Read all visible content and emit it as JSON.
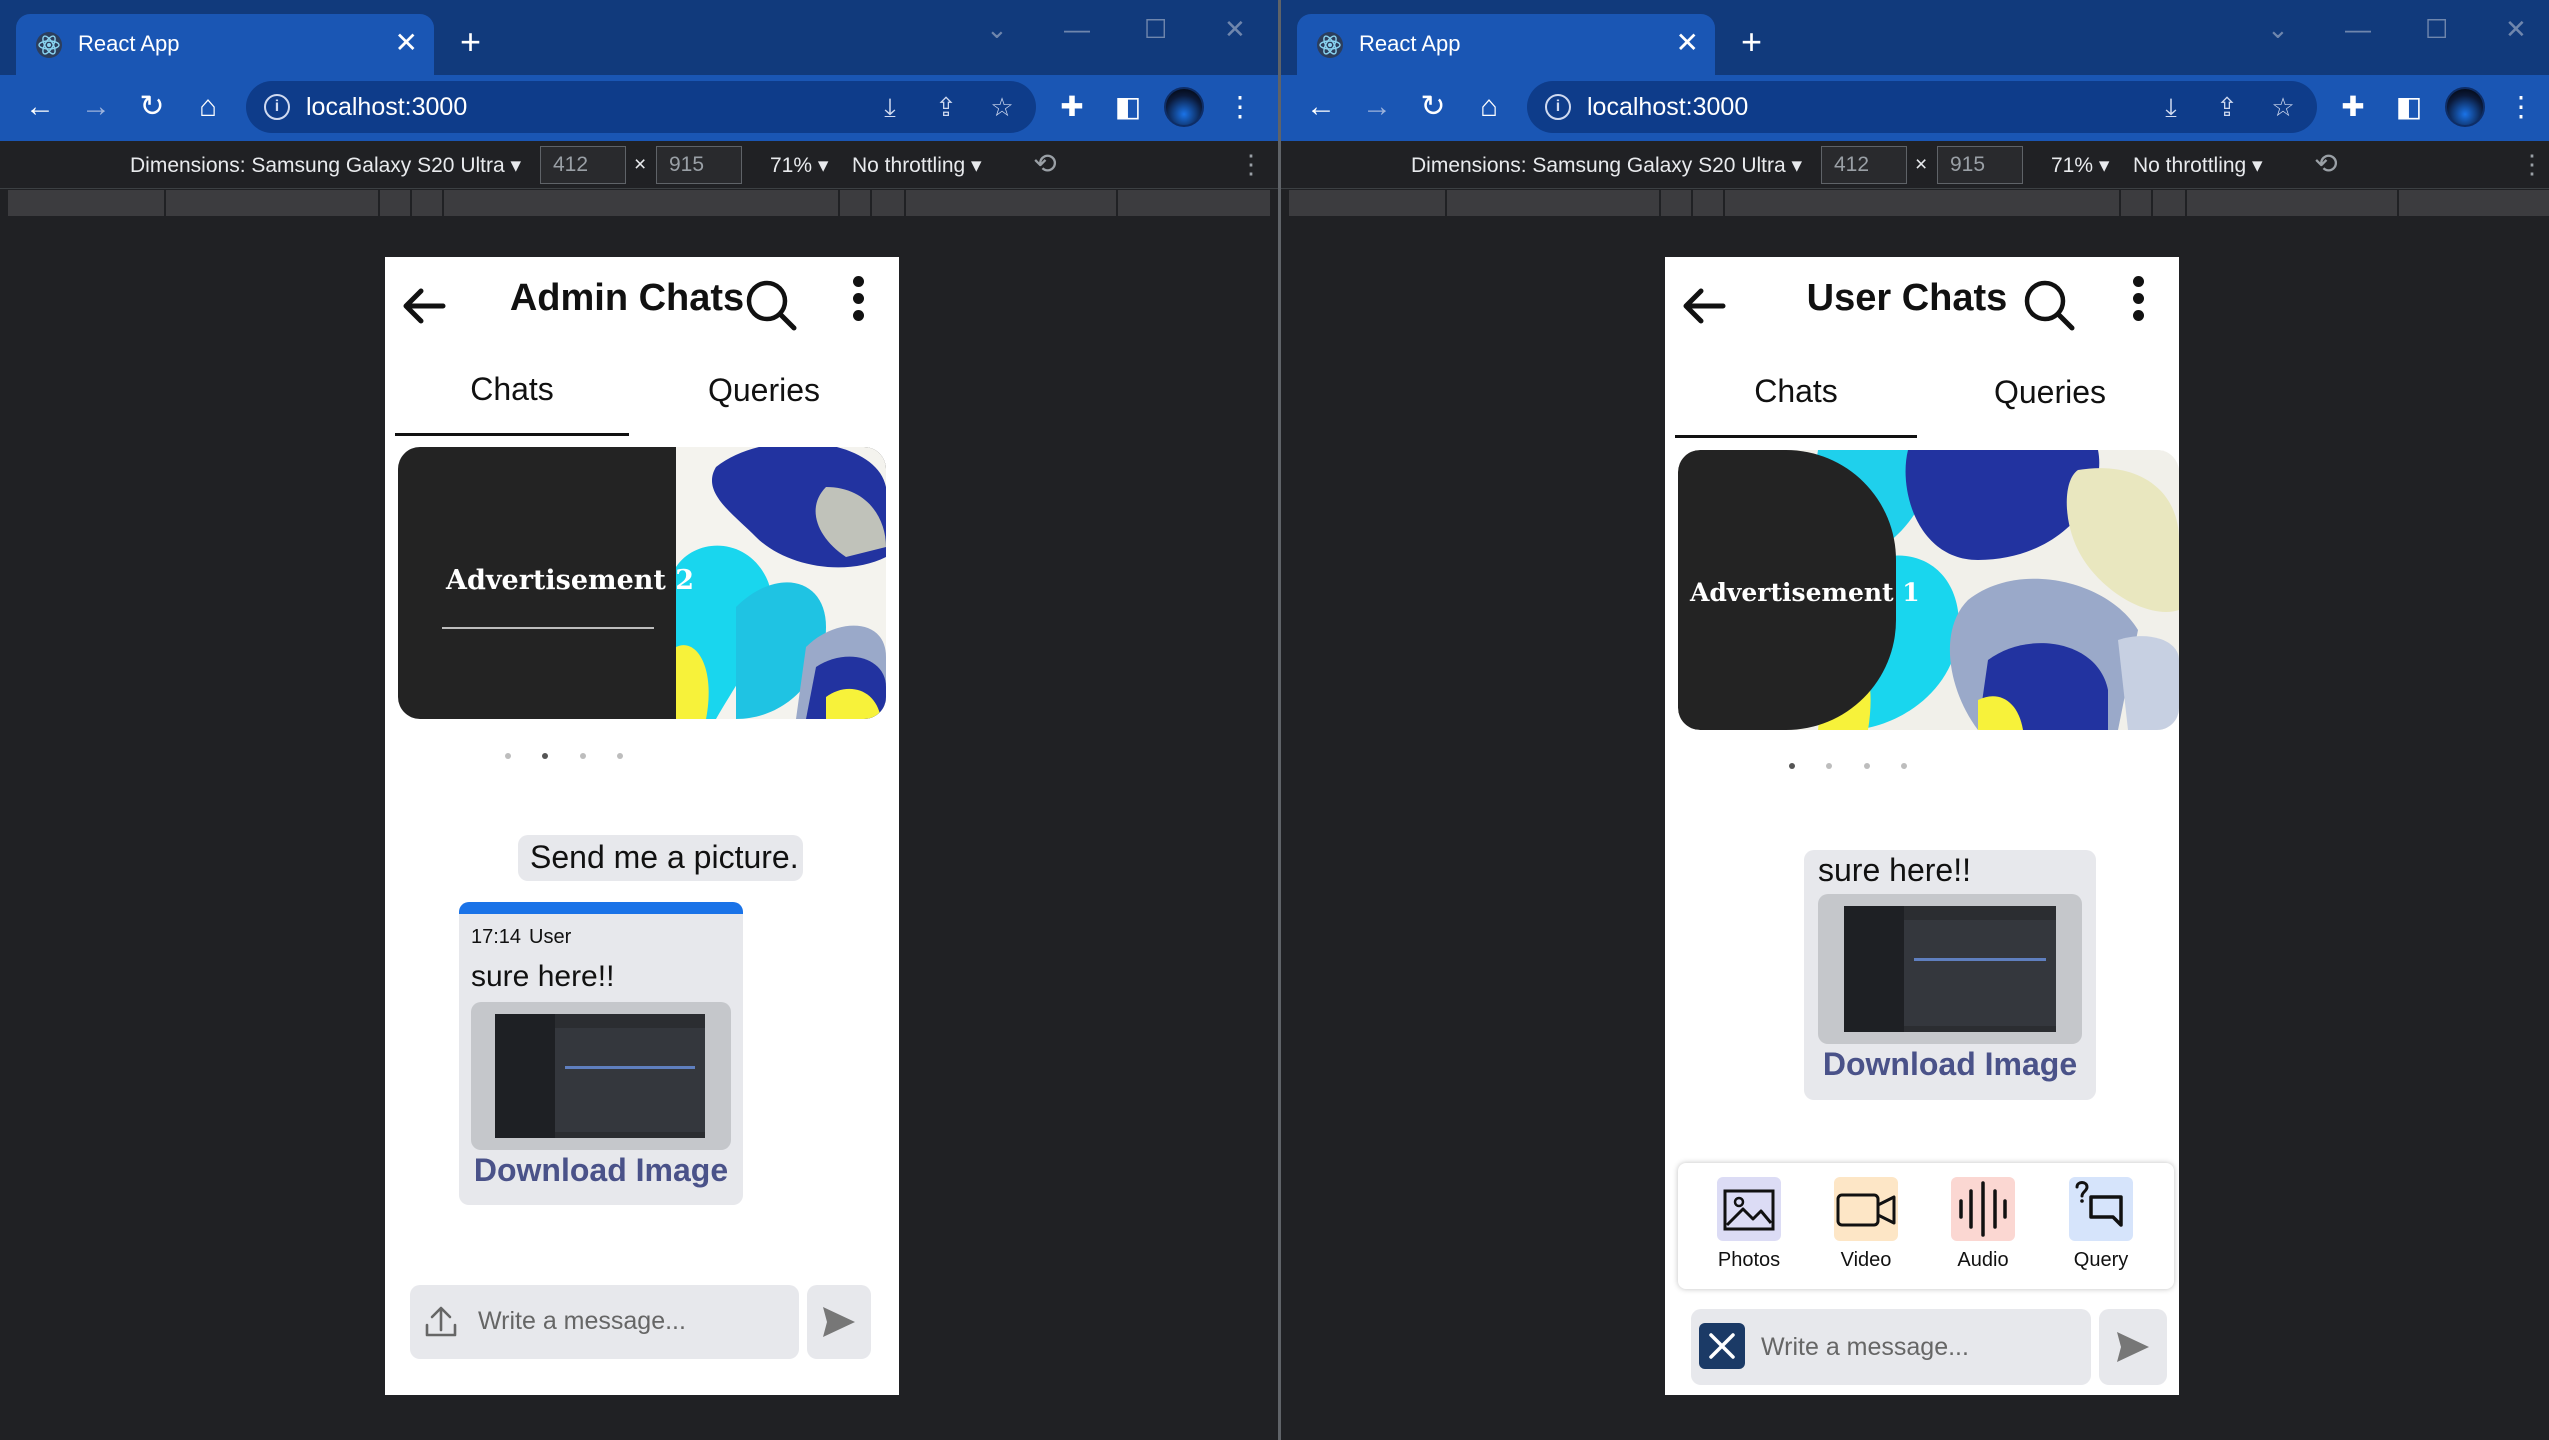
{
  "left_window": {
    "tab_title": "React App",
    "url": "localhost:3000",
    "device_toolbar": {
      "dimensions_label": "Dimensions: Samsung Galaxy S20 Ultra ▾",
      "width_value": "412",
      "times": "×",
      "height_value": "915",
      "zoom": "71% ▾",
      "throttling": "No throttling ▾"
    },
    "app": {
      "title": "Admin Chats",
      "tabs": [
        "Chats",
        "Queries"
      ],
      "active_tab": "Chats",
      "advertisement": "Advertisement 2",
      "carousel_active_index": 1,
      "carousel_dots": 4,
      "messages": {
        "incoming_text": "Send me a picture.",
        "card_time": "17:14",
        "card_sender": "User",
        "card_text": "sure here!!",
        "download_label": "Download Image"
      },
      "composer": {
        "placeholder": "Write a message...",
        "upload_icon": "upload-icon",
        "send_icon": "send-icon"
      }
    }
  },
  "right_window": {
    "tab_title": "React App",
    "url": "localhost:3000",
    "device_toolbar": {
      "dimensions_label": "Dimensions: Samsung Galaxy S20 Ultra ▾",
      "width_value": "412",
      "times": "×",
      "height_value": "915",
      "zoom": "71% ▾",
      "throttling": "No throttling ▾"
    },
    "app": {
      "title": "User Chats",
      "tabs": [
        "Chats",
        "Queries"
      ],
      "active_tab": "Chats",
      "advertisement": "Advertisement 1",
      "carousel_active_index": 0,
      "carousel_dots": 4,
      "messages": {
        "card_text": "sure here!!",
        "download_label": "Download Image"
      },
      "attachments": [
        {
          "label": "Photos",
          "icon": "image-icon",
          "color": "#dcdcf5"
        },
        {
          "label": "Video",
          "icon": "video-icon",
          "color": "#fde6c6"
        },
        {
          "label": "Audio",
          "icon": "audio-icon",
          "color": "#fbd7d2"
        },
        {
          "label": "Query",
          "icon": "query-icon",
          "color": "#d6e4fb"
        }
      ],
      "composer": {
        "placeholder": "Write a message...",
        "close_icon": "close-icon",
        "send_icon": "send-icon"
      }
    }
  },
  "colors": {
    "chrome_titlebar": "#113a7c",
    "chrome_toolbar": "#1a56b4",
    "devtools_bg": "#202124",
    "bubble_bg": "#e7e8ec",
    "download_link": "#4a5289",
    "card_accent": "#1a73e8"
  }
}
